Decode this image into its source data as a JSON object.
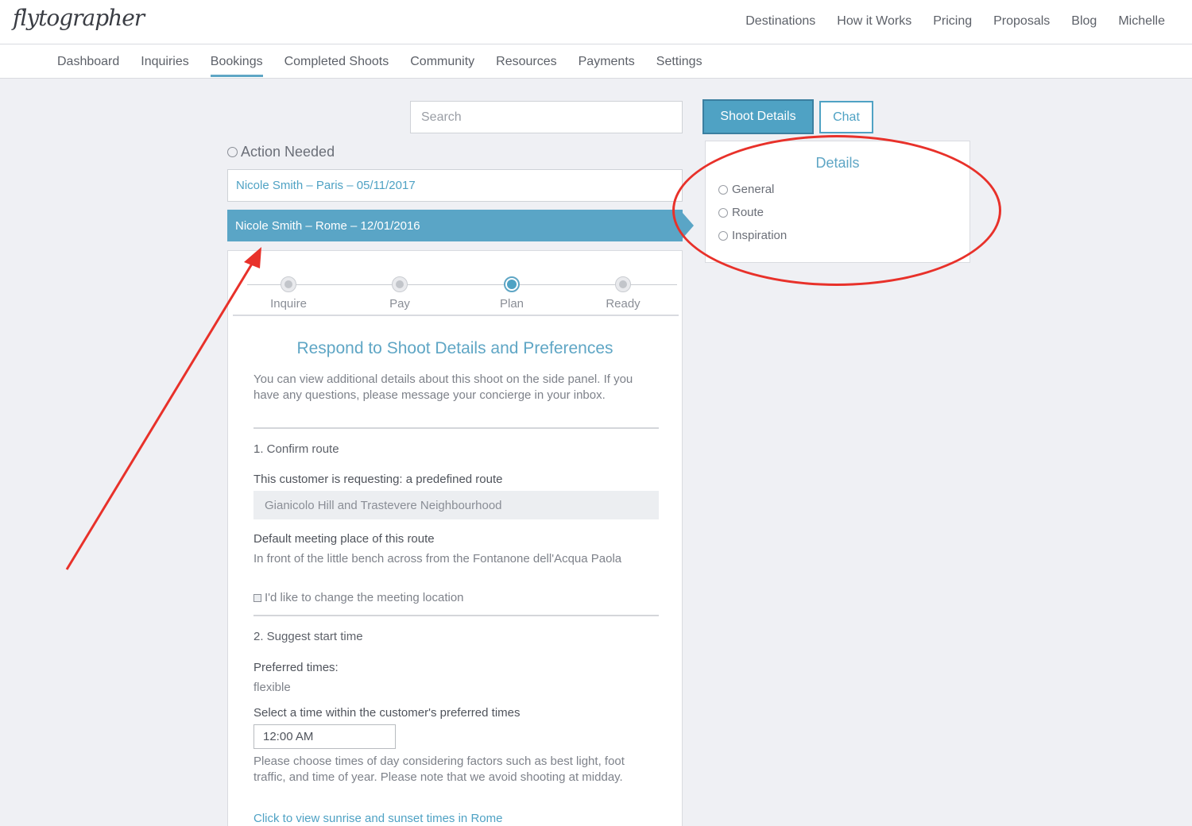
{
  "brand": {
    "logo_text": "flytographer"
  },
  "top_nav": [
    "Destinations",
    "How it Works",
    "Pricing",
    "Proposals",
    "Blog",
    "Michelle"
  ],
  "sub_nav": {
    "items": [
      "Dashboard",
      "Inquiries",
      "Bookings",
      "Completed Shoots",
      "Community",
      "Resources",
      "Payments",
      "Settings"
    ],
    "active": "Bookings"
  },
  "search": {
    "placeholder": "Search"
  },
  "tabs": {
    "shoot_details": "Shoot Details",
    "chat": "Chat"
  },
  "details_panel": {
    "title": "Details",
    "items": [
      "General",
      "Route",
      "Inspiration"
    ]
  },
  "action_needed": "Action Needed",
  "bookings": [
    "Nicole Smith – Paris – 05/11/2017",
    "Nicole Smith – Rome – 12/01/2016"
  ],
  "steps": {
    "items": [
      "Inquire",
      "Pay",
      "Plan",
      "Ready"
    ],
    "active": "Plan"
  },
  "main": {
    "title": "Respond to Shoot Details and Preferences",
    "intro": "You can view additional details about this shoot on the side panel. If you have any questions, please message your concierge in your inbox.",
    "section1": {
      "heading": "1. Confirm route",
      "requesting_label": "This customer is requesting: a predefined route",
      "route_value": "Gianicolo Hill and Trastevere Neighbourhood",
      "meeting_label": "Default meeting place of this route",
      "meeting_value": "In front of the little bench across from the Fontanone dell'Acqua Paola",
      "change_location_label": "I'd like to change the meeting location"
    },
    "section2": {
      "heading": "2. Suggest start time",
      "preferred_label": "Preferred times:",
      "preferred_value": "flexible",
      "select_label": "Select a time within the customer's preferred times",
      "time_value": "12:00 AM",
      "note": "Please choose times of day considering factors such as best light, foot traffic, and time of year. Please note that we avoid shooting at midday.",
      "link": "Click to view sunrise and sunset times in Rome"
    }
  },
  "annotation_color": "#e8312a",
  "accent_color": "#4fa2c4"
}
